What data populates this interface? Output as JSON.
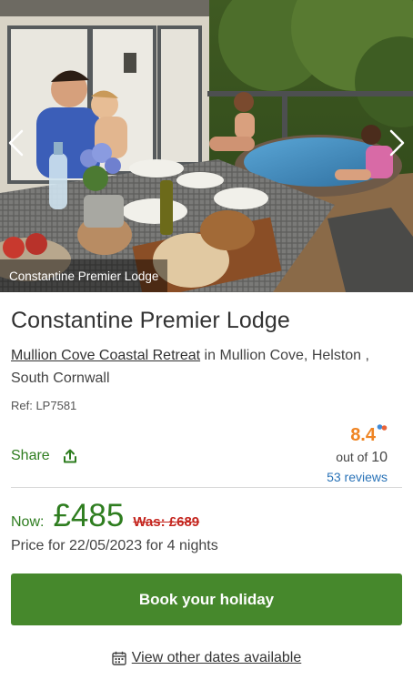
{
  "gallery": {
    "caption": "Constantine Premier Lodge",
    "prev_icon": "chevron-left-icon",
    "next_icon": "chevron-right-icon"
  },
  "property": {
    "title": "Constantine Premier Lodge",
    "park_name": "Mullion Cove Coastal Retreat",
    "location_text": " in Mullion Cove, Helston , South Cornwall",
    "ref": "Ref: LP7581"
  },
  "share": {
    "label": "Share",
    "icon": "share-upload-icon"
  },
  "rating": {
    "score": "8.4",
    "out_of_prefix": "out of ",
    "out_of_value": "10",
    "reviews": "53 reviews"
  },
  "pricing": {
    "now_label": "Now:",
    "now_price": "£485",
    "was_price": "Was: £689",
    "price_for": "Price for 22/05/2023 for 4 nights"
  },
  "actions": {
    "book_label": "Book your holiday",
    "other_dates_label": "View other dates available",
    "other_dates_icon": "calendar-icon"
  },
  "colors": {
    "brand_green": "#46882c",
    "text_green": "#2e7d1f",
    "rating_orange": "#ef8423",
    "link_blue": "#2a73b8",
    "was_red": "#c4251e"
  }
}
